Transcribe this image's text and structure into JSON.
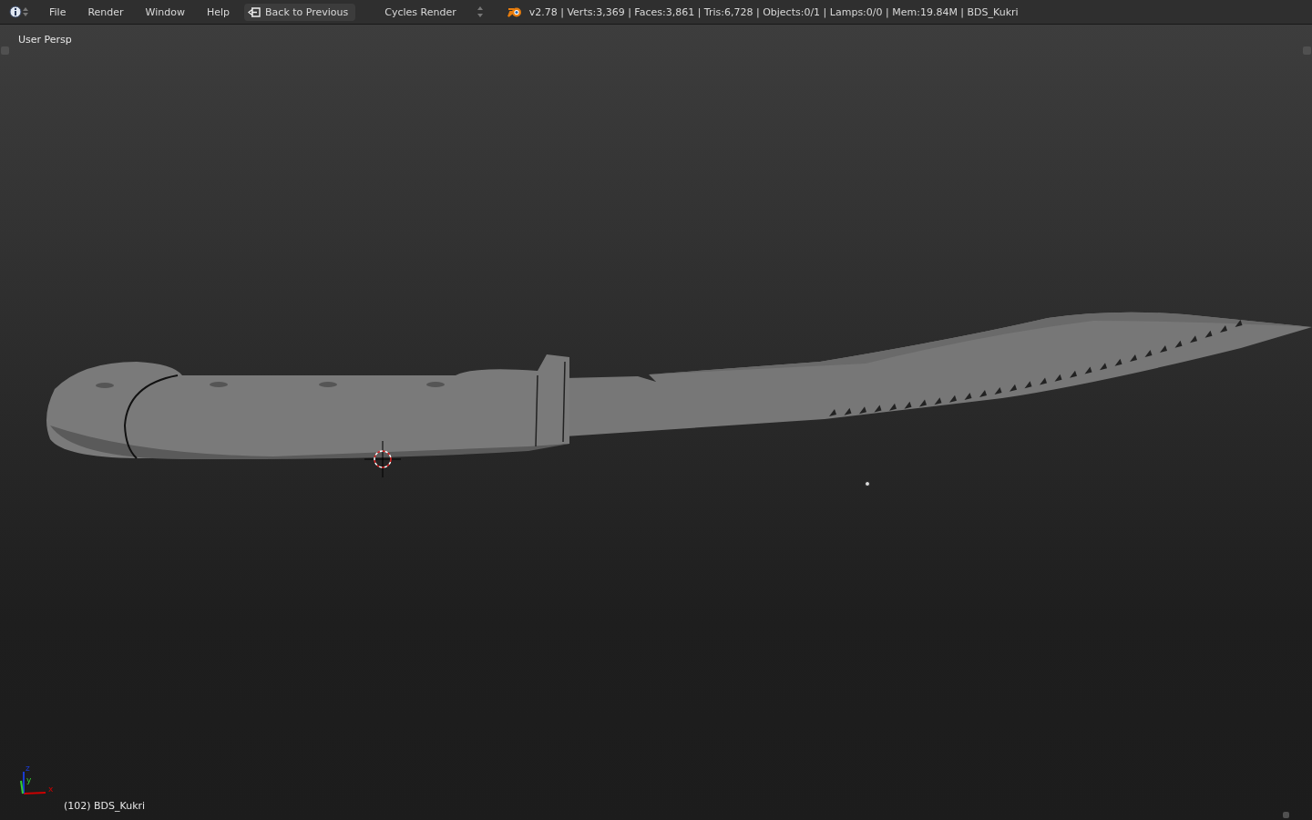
{
  "top_bar": {
    "menus": [
      "File",
      "Render",
      "Window",
      "Help"
    ],
    "back_button": "Back to Previous",
    "render_engine": "Cycles Render",
    "stats": "v2.78 | Verts:3,369 | Faces:3,861 | Tris:6,728 | Objects:0/1 | Lamps:0/0 | Mem:19.84M | BDS_Kukri"
  },
  "viewport": {
    "view_label": "User Persp",
    "object_label": "(102) BDS_Kukri",
    "axes": {
      "x": "x",
      "y": "y",
      "z": "z"
    }
  }
}
